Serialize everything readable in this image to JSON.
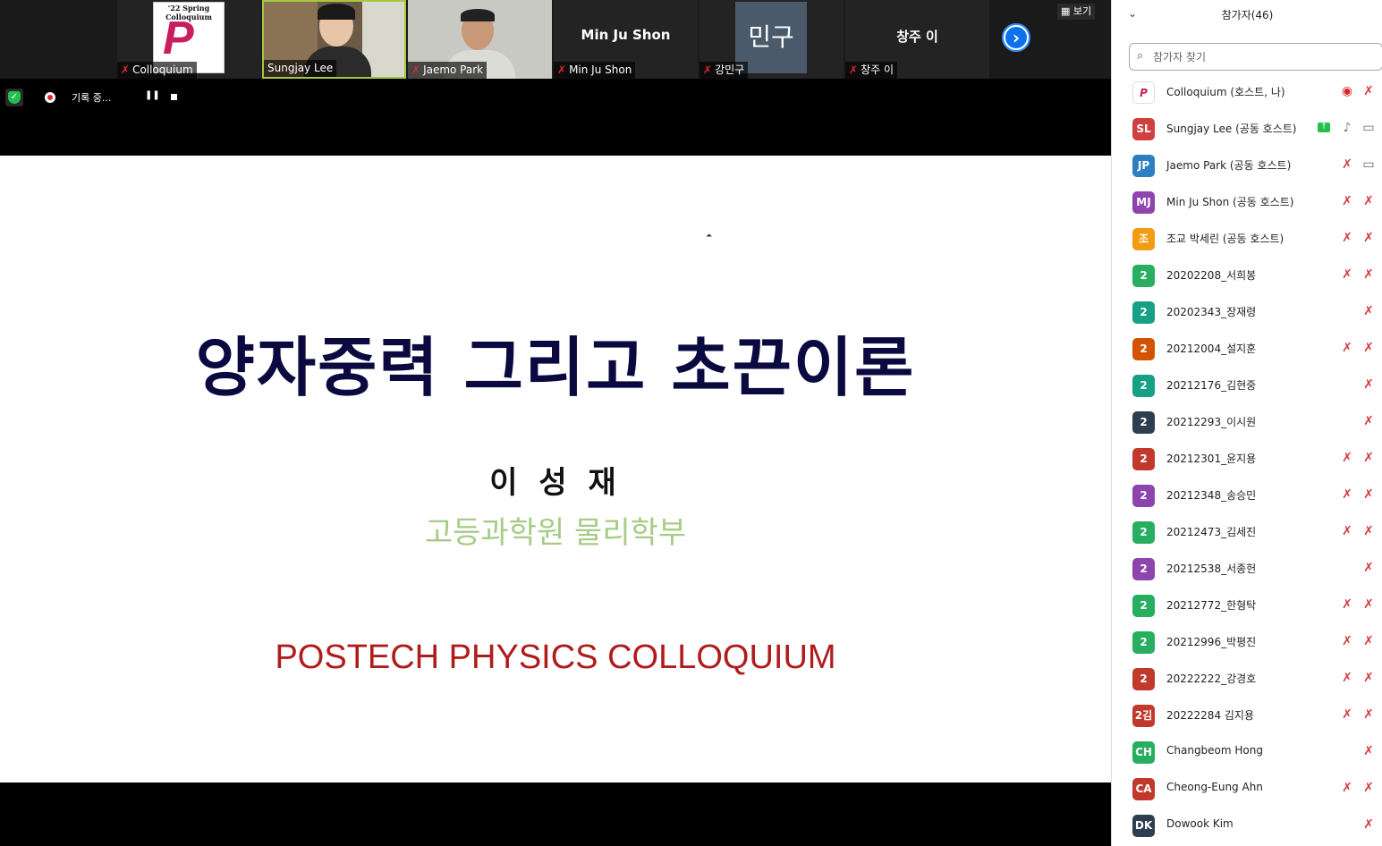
{
  "video_strip": {
    "tiles": [
      {
        "name": "Colloquium",
        "logo_top": "'22 Spring Colloquium",
        "logo_letter": "P"
      },
      {
        "name": "Sungjay Lee"
      },
      {
        "name": "Jaemo Park"
      },
      {
        "name": "Min Ju Shon",
        "big_name": "Min Ju Shon"
      },
      {
        "name": "강민구",
        "avatar_text": "민구"
      },
      {
        "name": "창주 이",
        "big_name": "창주 이"
      }
    ],
    "view_label": "보기"
  },
  "recording": {
    "label": "기록 중..."
  },
  "slide": {
    "title": "양자중력 그리고 초끈이론",
    "author": "이 성 재",
    "affiliation": "고등과학원 물리학부",
    "colloquium": "POSTECH PHYSICS COLLOQUIUM"
  },
  "participants_panel": {
    "title": "참가자(46)",
    "search_placeholder": "참가자 찾기",
    "participants": [
      {
        "initials": "P",
        "name": "Colloquium (호스트, 나)",
        "avatar_color": "#ffffff",
        "icons": [
          "rec-icon",
          "mic-off"
        ]
      },
      {
        "initials": "SL",
        "name": "Sungjay Lee (공동 호스트)",
        "avatar_color": "#d13f3f",
        "icons": [
          "share",
          "mic-on",
          "video-on"
        ]
      },
      {
        "initials": "JP",
        "name": "Jaemo Park (공동 호스트)",
        "avatar_color": "#2d7fc1",
        "icons": [
          "mic-off",
          "video-on"
        ]
      },
      {
        "initials": "MJ",
        "name": "Min Ju Shon (공동 호스트)",
        "avatar_color": "#8e44ad",
        "icons": [
          "mic-off",
          "video-off"
        ]
      },
      {
        "initials": "조",
        "name": "조교 박세린 (공동 호스트)",
        "avatar_color": "#f39c12",
        "icons": [
          "mic-off",
          "video-off"
        ]
      },
      {
        "initials": "2",
        "name": "20202208_서희봉",
        "avatar_color": "#27ae60",
        "icons": [
          "mic-off",
          "video-off"
        ]
      },
      {
        "initials": "2",
        "name": "20202343_장재령",
        "avatar_color": "#16a085",
        "icons": [
          "mic-off"
        ]
      },
      {
        "initials": "2",
        "name": "20212004_설지훈",
        "avatar_color": "#d35400",
        "icons": [
          "mic-off",
          "video-off"
        ]
      },
      {
        "initials": "2",
        "name": "20212176_김현중",
        "avatar_color": "#16a085",
        "icons": [
          "mic-off"
        ]
      },
      {
        "initials": "2",
        "name": "20212293_이시원",
        "avatar_color": "#2c3e50",
        "icons": [
          "mic-off"
        ]
      },
      {
        "initials": "2",
        "name": "20212301_윤지용",
        "avatar_color": "#c0392b",
        "icons": [
          "mic-off",
          "video-off"
        ]
      },
      {
        "initials": "2",
        "name": "20212348_송승민",
        "avatar_color": "#8e44ad",
        "icons": [
          "mic-off",
          "video-off"
        ]
      },
      {
        "initials": "2",
        "name": "20212473_김세진",
        "avatar_color": "#27ae60",
        "icons": [
          "mic-off",
          "video-off"
        ]
      },
      {
        "initials": "2",
        "name": "20212538_서종헌",
        "avatar_color": "#8e44ad",
        "icons": [
          "mic-off"
        ]
      },
      {
        "initials": "2",
        "name": "20212772_한형탁",
        "avatar_color": "#27ae60",
        "icons": [
          "mic-off",
          "video-off"
        ]
      },
      {
        "initials": "2",
        "name": "20212996_박평진",
        "avatar_color": "#27ae60",
        "icons": [
          "mic-off",
          "video-off"
        ]
      },
      {
        "initials": "2",
        "name": "20222222_강경호",
        "avatar_color": "#c0392b",
        "icons": [
          "mic-off",
          "video-off"
        ]
      },
      {
        "initials": "2김",
        "name": "20222284 김지용",
        "avatar_color": "#c0392b",
        "icons": [
          "mic-off",
          "video-off"
        ]
      },
      {
        "initials": "CH",
        "name": "Changbeom Hong",
        "avatar_color": "#27ae60",
        "icons": [
          "mic-off"
        ]
      },
      {
        "initials": "CA",
        "name": "Cheong-Eung Ahn",
        "avatar_color": "#c0392b",
        "icons": [
          "mic-off",
          "video-off"
        ]
      },
      {
        "initials": "DK",
        "name": "Dowook Kim",
        "avatar_color": "#2c3e50",
        "icons": [
          "mic-off"
        ]
      }
    ]
  }
}
